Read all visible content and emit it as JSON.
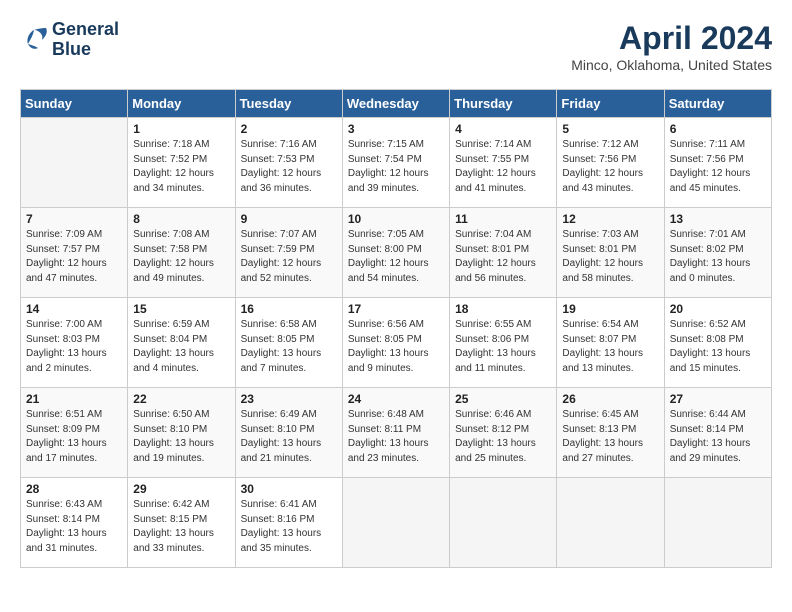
{
  "header": {
    "logo_line1": "General",
    "logo_line2": "Blue",
    "month_title": "April 2024",
    "location": "Minco, Oklahoma, United States"
  },
  "days_of_week": [
    "Sunday",
    "Monday",
    "Tuesday",
    "Wednesday",
    "Thursday",
    "Friday",
    "Saturday"
  ],
  "weeks": [
    [
      {
        "day": "",
        "info": ""
      },
      {
        "day": "1",
        "info": "Sunrise: 7:18 AM\nSunset: 7:52 PM\nDaylight: 12 hours\nand 34 minutes."
      },
      {
        "day": "2",
        "info": "Sunrise: 7:16 AM\nSunset: 7:53 PM\nDaylight: 12 hours\nand 36 minutes."
      },
      {
        "day": "3",
        "info": "Sunrise: 7:15 AM\nSunset: 7:54 PM\nDaylight: 12 hours\nand 39 minutes."
      },
      {
        "day": "4",
        "info": "Sunrise: 7:14 AM\nSunset: 7:55 PM\nDaylight: 12 hours\nand 41 minutes."
      },
      {
        "day": "5",
        "info": "Sunrise: 7:12 AM\nSunset: 7:56 PM\nDaylight: 12 hours\nand 43 minutes."
      },
      {
        "day": "6",
        "info": "Sunrise: 7:11 AM\nSunset: 7:56 PM\nDaylight: 12 hours\nand 45 minutes."
      }
    ],
    [
      {
        "day": "7",
        "info": "Sunrise: 7:09 AM\nSunset: 7:57 PM\nDaylight: 12 hours\nand 47 minutes."
      },
      {
        "day": "8",
        "info": "Sunrise: 7:08 AM\nSunset: 7:58 PM\nDaylight: 12 hours\nand 49 minutes."
      },
      {
        "day": "9",
        "info": "Sunrise: 7:07 AM\nSunset: 7:59 PM\nDaylight: 12 hours\nand 52 minutes."
      },
      {
        "day": "10",
        "info": "Sunrise: 7:05 AM\nSunset: 8:00 PM\nDaylight: 12 hours\nand 54 minutes."
      },
      {
        "day": "11",
        "info": "Sunrise: 7:04 AM\nSunset: 8:01 PM\nDaylight: 12 hours\nand 56 minutes."
      },
      {
        "day": "12",
        "info": "Sunrise: 7:03 AM\nSunset: 8:01 PM\nDaylight: 12 hours\nand 58 minutes."
      },
      {
        "day": "13",
        "info": "Sunrise: 7:01 AM\nSunset: 8:02 PM\nDaylight: 13 hours\nand 0 minutes."
      }
    ],
    [
      {
        "day": "14",
        "info": "Sunrise: 7:00 AM\nSunset: 8:03 PM\nDaylight: 13 hours\nand 2 minutes."
      },
      {
        "day": "15",
        "info": "Sunrise: 6:59 AM\nSunset: 8:04 PM\nDaylight: 13 hours\nand 4 minutes."
      },
      {
        "day": "16",
        "info": "Sunrise: 6:58 AM\nSunset: 8:05 PM\nDaylight: 13 hours\nand 7 minutes."
      },
      {
        "day": "17",
        "info": "Sunrise: 6:56 AM\nSunset: 8:05 PM\nDaylight: 13 hours\nand 9 minutes."
      },
      {
        "day": "18",
        "info": "Sunrise: 6:55 AM\nSunset: 8:06 PM\nDaylight: 13 hours\nand 11 minutes."
      },
      {
        "day": "19",
        "info": "Sunrise: 6:54 AM\nSunset: 8:07 PM\nDaylight: 13 hours\nand 13 minutes."
      },
      {
        "day": "20",
        "info": "Sunrise: 6:52 AM\nSunset: 8:08 PM\nDaylight: 13 hours\nand 15 minutes."
      }
    ],
    [
      {
        "day": "21",
        "info": "Sunrise: 6:51 AM\nSunset: 8:09 PM\nDaylight: 13 hours\nand 17 minutes."
      },
      {
        "day": "22",
        "info": "Sunrise: 6:50 AM\nSunset: 8:10 PM\nDaylight: 13 hours\nand 19 minutes."
      },
      {
        "day": "23",
        "info": "Sunrise: 6:49 AM\nSunset: 8:10 PM\nDaylight: 13 hours\nand 21 minutes."
      },
      {
        "day": "24",
        "info": "Sunrise: 6:48 AM\nSunset: 8:11 PM\nDaylight: 13 hours\nand 23 minutes."
      },
      {
        "day": "25",
        "info": "Sunrise: 6:46 AM\nSunset: 8:12 PM\nDaylight: 13 hours\nand 25 minutes."
      },
      {
        "day": "26",
        "info": "Sunrise: 6:45 AM\nSunset: 8:13 PM\nDaylight: 13 hours\nand 27 minutes."
      },
      {
        "day": "27",
        "info": "Sunrise: 6:44 AM\nSunset: 8:14 PM\nDaylight: 13 hours\nand 29 minutes."
      }
    ],
    [
      {
        "day": "28",
        "info": "Sunrise: 6:43 AM\nSunset: 8:14 PM\nDaylight: 13 hours\nand 31 minutes."
      },
      {
        "day": "29",
        "info": "Sunrise: 6:42 AM\nSunset: 8:15 PM\nDaylight: 13 hours\nand 33 minutes."
      },
      {
        "day": "30",
        "info": "Sunrise: 6:41 AM\nSunset: 8:16 PM\nDaylight: 13 hours\nand 35 minutes."
      },
      {
        "day": "",
        "info": ""
      },
      {
        "day": "",
        "info": ""
      },
      {
        "day": "",
        "info": ""
      },
      {
        "day": "",
        "info": ""
      }
    ]
  ]
}
